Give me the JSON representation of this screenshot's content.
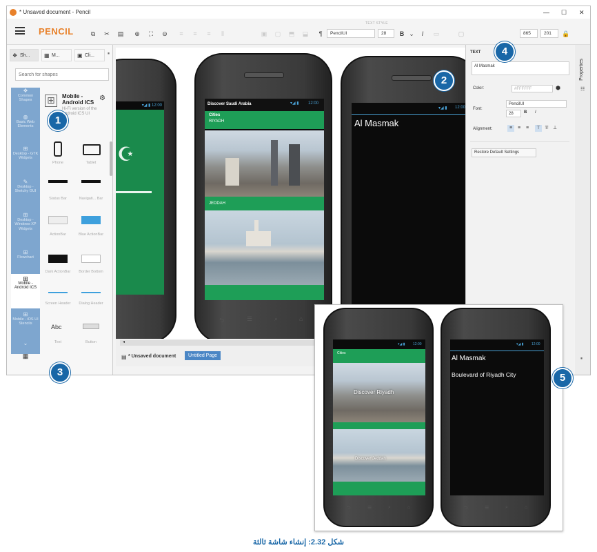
{
  "window": {
    "title": "* Unsaved document - Pencil",
    "controls": [
      "—",
      "☐",
      "✕"
    ]
  },
  "toolbar": {
    "menu_icon": "hamburger-icon",
    "logo": "PENCIL",
    "section_text_style": "TEXT STYLE",
    "font_name": "PencilUI",
    "font_size": "28",
    "x_value": "865",
    "y_value": "201"
  },
  "left_panel": {
    "tabs": [
      "Sh...",
      "M...",
      "Cli..."
    ],
    "search_placeholder": "Search for shapes",
    "categories": [
      "Common Shapes",
      "Basic Web Elements",
      "Desktop - GTK Widgets",
      "Desktop - Sketchy GUI",
      "Desktop - Windows XP Widgets",
      "Flowchart",
      "Mobile - Android ICS",
      "Mobile - iOS UI Stencils"
    ],
    "selected_category": "Mobile - Android ICS",
    "collection_title": "Mobile - Android ICS",
    "collection_desc": "Hi-Fi version of the Android ICS UI",
    "shapes": [
      "Phone",
      "Tablet",
      "Status Bar",
      "Navigati... Bar",
      "ActionBar",
      "Blue ActionBar",
      "Dark ActionBar",
      "Border Bottom",
      "Screen Header",
      "Dialog Header",
      "Text",
      "Button"
    ],
    "text_shape_glyph": "Abc"
  },
  "canvas": {
    "phone2": {
      "title": "Discover Saudi Arabia",
      "time": "12:00",
      "section": "Cities",
      "city1": "RIYADH",
      "city2": "JEDDAH"
    },
    "phone3": {
      "time": "12:00",
      "text": "Al Masmak"
    }
  },
  "bottom": {
    "doc_tab": "* Unsaved document",
    "page_tab": "Untitled Page"
  },
  "right_panel": {
    "header": "TEXT",
    "text_value": "Al Masmak",
    "color_label": "Color:",
    "color_value": "#FFFFFF",
    "font_label": "Font:",
    "font_name": "PencilUI",
    "font_size": "28",
    "alignment_label": "Alignment:",
    "restore_button": "Restore Default Settings",
    "properties_tab": "Properties"
  },
  "overlay": {
    "phone_a": {
      "time": "12:00",
      "section": "Cities",
      "city1": "Discover Riyadh",
      "city2": "Discover Jeddah"
    },
    "phone_b": {
      "time": "12:00",
      "line1": "Al Masmak",
      "line2": "Boulevard of Riyadh City"
    }
  },
  "callouts": [
    "1",
    "2",
    "3",
    "4",
    "5"
  ],
  "caption": "شكل 2.32: إنشاء شاشة ثالثة",
  "colors": {
    "accent_blue": "#1967a7",
    "android_green": "#1e9e57",
    "category_blue": "#7ea6cf",
    "logo_orange": "#e8812a"
  }
}
